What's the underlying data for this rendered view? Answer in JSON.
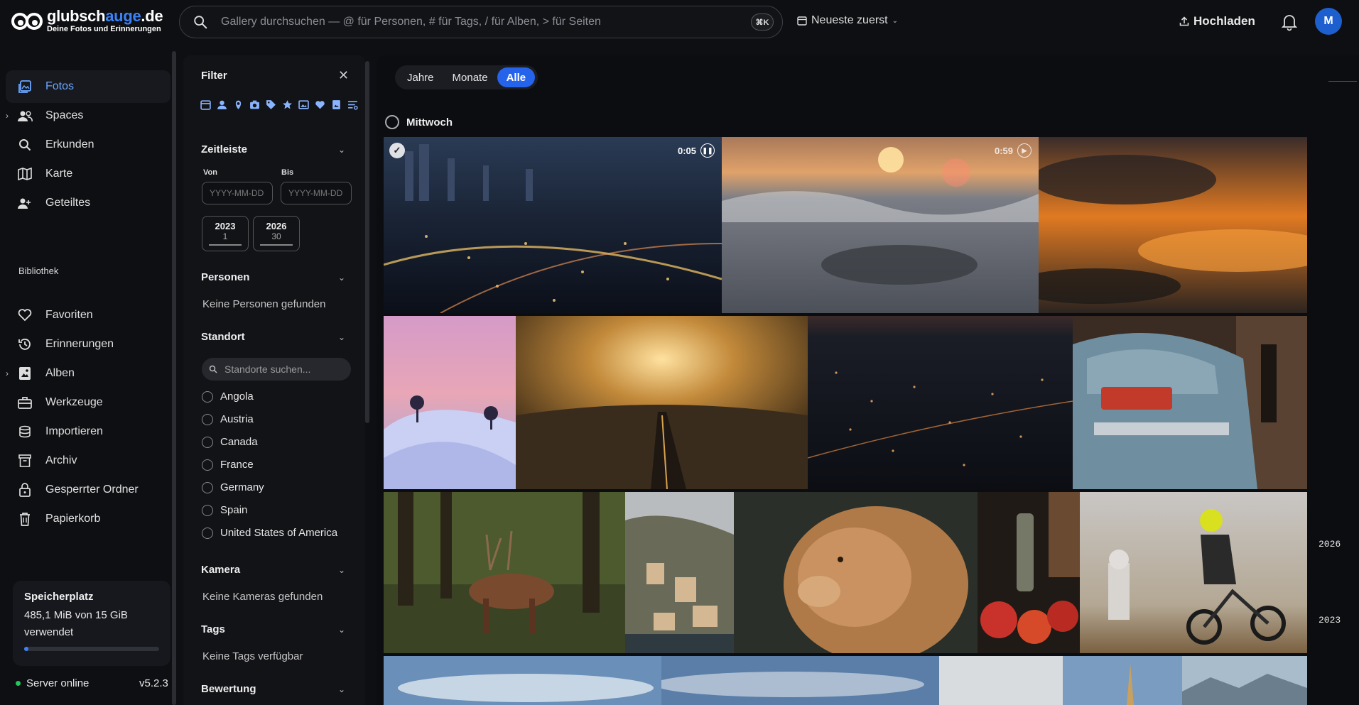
{
  "header": {
    "logo_name_start": "glubsch",
    "logo_name_accent": "auge",
    "logo_name_end": ".de",
    "logo_subtitle": "Deine Fotos und Erinnerungen",
    "search_placeholder": "Gallery durchsuchen — @ für Personen, # für Tags, / für Alben, > für Seiten",
    "search_shortcut": "⌘K",
    "sort_label": "Neueste zuerst",
    "upload_label": "Hochladen",
    "avatar_initial": "M",
    "accent_color": "#3b82f6"
  },
  "sidebar": {
    "items": [
      {
        "label": "Fotos",
        "icon": "photos-icon",
        "active": true
      },
      {
        "label": "Spaces",
        "icon": "people-icon",
        "expandable": true
      },
      {
        "label": "Erkunden",
        "icon": "search-icon"
      },
      {
        "label": "Karte",
        "icon": "map-icon"
      },
      {
        "label": "Geteiltes",
        "icon": "shared-icon"
      }
    ],
    "library_label": "Bibliothek",
    "library_items": [
      {
        "label": "Favoriten",
        "icon": "heart-icon"
      },
      {
        "label": "Erinnerungen",
        "icon": "history-icon"
      },
      {
        "label": "Alben",
        "icon": "album-icon",
        "expandable": true
      },
      {
        "label": "Werkzeuge",
        "icon": "toolbox-icon"
      },
      {
        "label": "Importieren",
        "icon": "import-icon"
      },
      {
        "label": "Archiv",
        "icon": "archive-icon"
      },
      {
        "label": "Gesperrter Ordner",
        "icon": "lock-icon"
      },
      {
        "label": "Papierkorb",
        "icon": "trash-icon"
      }
    ],
    "storage": {
      "title": "Speicherplatz",
      "usage": "485,1 MiB von 15 GiB verwendet",
      "fraction_used": 0.032
    },
    "server_status": "Server online",
    "version": "v5.2.3"
  },
  "filter": {
    "title": "Filter",
    "timeline": {
      "title": "Zeitleiste",
      "from_label": "Von",
      "to_label": "Bis",
      "date_placeholder": "YYYY-MM-DD",
      "years": [
        {
          "year": "2023",
          "count": "1"
        },
        {
          "year": "2026",
          "count": "30"
        }
      ]
    },
    "people": {
      "title": "Personen",
      "empty": "Keine Personen gefunden"
    },
    "location": {
      "title": "Standort",
      "search_placeholder": "Standorte suchen...",
      "options": [
        "Angola",
        "Austria",
        "Canada",
        "France",
        "Germany",
        "Spain",
        "United States of America"
      ]
    },
    "camera": {
      "title": "Kamera",
      "empty": "Keine Kameras gefunden"
    },
    "tags": {
      "title": "Tags",
      "empty": "Keine Tags verfügbar"
    },
    "rating": {
      "title": "Bewertung"
    }
  },
  "gallery": {
    "view_options": [
      "Jahre",
      "Monate",
      "Alle"
    ],
    "selected_view": "Alle",
    "day_label": "Mittwoch",
    "videos": [
      {
        "duration": "0:05"
      },
      {
        "duration": "0:59"
      }
    ],
    "year_markers": [
      "2026",
      "2023"
    ]
  }
}
